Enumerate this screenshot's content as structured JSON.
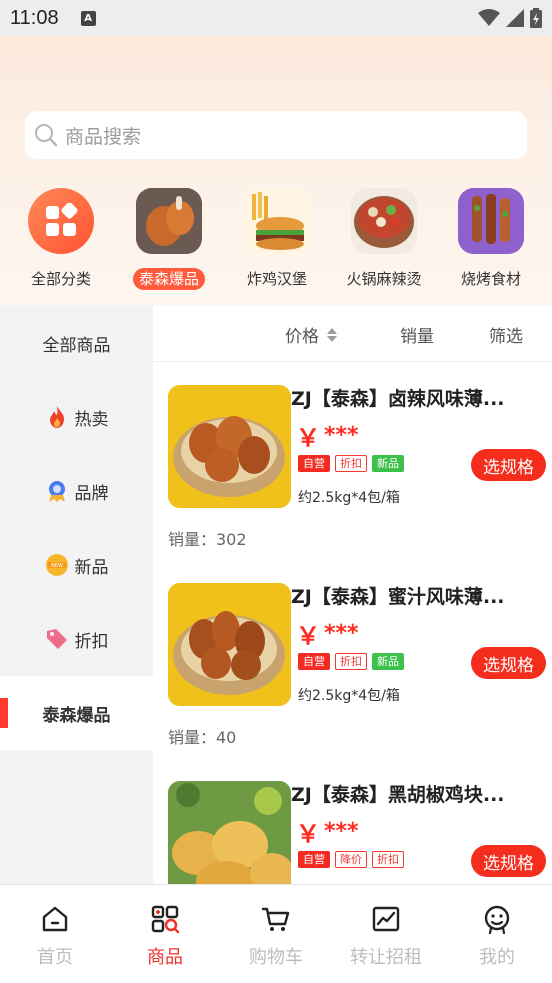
{
  "status": {
    "time": "11:08"
  },
  "search": {
    "placeholder": "商品搜索"
  },
  "categories": [
    {
      "label": "全部分类",
      "icon": "grid-icon"
    },
    {
      "label": "泰森爆品",
      "icon": "chicken-drumstick-image",
      "active": true
    },
    {
      "label": "炸鸡汉堡",
      "icon": "burger-fries-image"
    },
    {
      "label": "火锅麻辣烫",
      "icon": "hotpot-image"
    },
    {
      "label": "烧烤食材",
      "icon": "bbq-skewers-image"
    }
  ],
  "sidebar": [
    {
      "label": "全部商品",
      "icon": ""
    },
    {
      "label": "热卖",
      "icon": "fire-icon"
    },
    {
      "label": "品牌",
      "icon": "badge-icon"
    },
    {
      "label": "新品",
      "icon": "new-icon"
    },
    {
      "label": "折扣",
      "icon": "tag-icon"
    },
    {
      "label": "泰森爆品",
      "icon": "",
      "active": true
    }
  ],
  "sort": {
    "price": "价格",
    "sales": "销量",
    "filter": "筛选"
  },
  "products": [
    {
      "title": "ZJ【泰森】卤辣风味薄...",
      "price": "***",
      "tags": [
        "自营",
        "折扣",
        "新品"
      ],
      "spec": "约2.5kg*4包/箱",
      "button": "选规格",
      "sales": "销量：302"
    },
    {
      "title": "ZJ【泰森】蜜汁风味薄...",
      "price": "***",
      "tags": [
        "自营",
        "折扣",
        "新品"
      ],
      "spec": "约2.5kg*4包/箱",
      "button": "选规格",
      "sales": "销量：40"
    },
    {
      "title": "ZJ【泰森】黑胡椒鸡块...",
      "price": "***",
      "tags": [
        "自营",
        "降价",
        "折扣"
      ],
      "spec": "",
      "button": "选规格",
      "sales": ""
    }
  ],
  "currency": "￥",
  "tabs": [
    {
      "label": "首页",
      "icon": "home-icon"
    },
    {
      "label": "商品",
      "icon": "products-icon",
      "active": true
    },
    {
      "label": "购物车",
      "icon": "cart-icon"
    },
    {
      "label": "转让招租",
      "icon": "chart-icon"
    },
    {
      "label": "我的",
      "icon": "profile-icon"
    }
  ],
  "colors": {
    "accent": "#f42d1c",
    "tab_active": "#f0302a",
    "tab_inactive": "#bdbdbd",
    "tag_green": "#3ec14a"
  }
}
